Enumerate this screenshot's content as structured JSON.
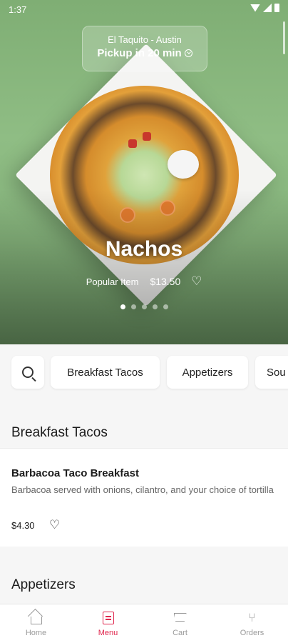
{
  "status_bar": {
    "time": "1:37"
  },
  "header": {
    "location": "El Taquito - Austin",
    "pickup": "Pickup in 20 min"
  },
  "hero": {
    "title": "Nachos",
    "label": "Popular Item",
    "price": "$13.50",
    "slide_count": 5,
    "active_slide": 1
  },
  "categories": [
    "Breakfast Tacos",
    "Appetizers",
    "Sou"
  ],
  "sections": [
    {
      "title": "Breakfast Tacos",
      "items": [
        {
          "name": "Barbacoa Taco Breakfast",
          "description": "Barbacoa served with onions, cilantro, and your choice of tortilla",
          "price": "$4.30"
        }
      ]
    },
    {
      "title": "Appetizers"
    }
  ],
  "bottom_nav": [
    {
      "label": "Home",
      "icon": "home-icon"
    },
    {
      "label": "Menu",
      "icon": "menu-icon",
      "active": true
    },
    {
      "label": "Cart",
      "icon": "cart-icon"
    },
    {
      "label": "Orders",
      "icon": "utensils-icon"
    }
  ],
  "colors": {
    "accent": "#e0284f",
    "hero_background": "#86b47c"
  }
}
